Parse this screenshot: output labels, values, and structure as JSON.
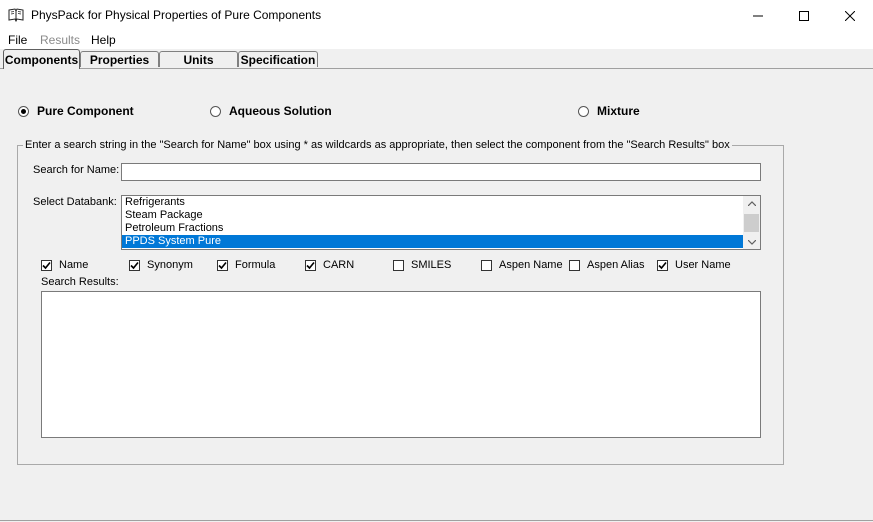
{
  "window": {
    "title": "PhysPack for Physical Properties of Pure Components",
    "icon": "book-icon",
    "controls": [
      "minimize-icon",
      "maximize-icon",
      "close-icon"
    ]
  },
  "menu": {
    "file": "File",
    "results": "Results",
    "help": "Help"
  },
  "tabs": [
    {
      "label": "Components",
      "active": true
    },
    {
      "label": "Properties",
      "active": false
    },
    {
      "label": "Units",
      "active": false
    },
    {
      "label": "Specification",
      "active": false
    }
  ],
  "mode": {
    "pure": "Pure Component",
    "aqueous": "Aqueous Solution",
    "mixture": "Mixture",
    "selected": "Pure Component"
  },
  "group": {
    "caption": "Enter a search string in the \"Search for Name\" box using * as wildcards as appropriate, then select the component from the \"Search Results\" box"
  },
  "search": {
    "label": "Search for Name:",
    "value": ""
  },
  "databank": {
    "label": "Select Databank:",
    "items": [
      "Refrigerants",
      "Steam Package",
      "Petroleum Fractions",
      "PPDS System Pure"
    ],
    "selected": "PPDS System Pure"
  },
  "filters": [
    {
      "label": "Name",
      "checked": true
    },
    {
      "label": "Synonym",
      "checked": true
    },
    {
      "label": "Formula",
      "checked": true
    },
    {
      "label": "CARN",
      "checked": true
    },
    {
      "label": "SMILES",
      "checked": false
    },
    {
      "label": "Aspen Name",
      "checked": false
    },
    {
      "label": "Aspen Alias",
      "checked": false
    },
    {
      "label": "User Name",
      "checked": true
    }
  ],
  "results": {
    "label": "Search Results:",
    "items": []
  },
  "colors": {
    "selection": "#0078d7",
    "window_bg": "#f0f0f0"
  }
}
